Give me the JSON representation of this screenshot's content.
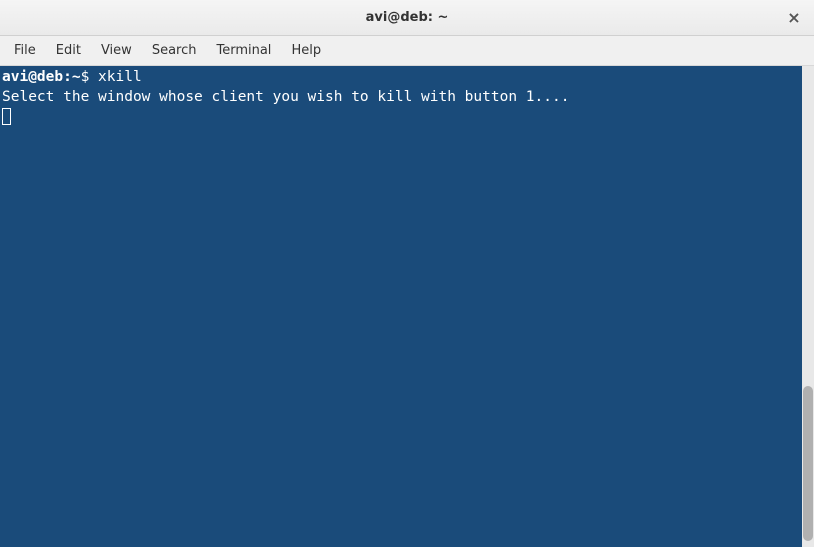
{
  "window": {
    "title": "avi@deb: ~",
    "close_label": "×"
  },
  "menu": {
    "items": [
      "File",
      "Edit",
      "View",
      "Search",
      "Terminal",
      "Help"
    ]
  },
  "terminal": {
    "prompt_user": "avi@deb",
    "prompt_path": "~",
    "prompt_symbol": "$",
    "command": "xkill",
    "output": "Select the window whose client you wish to kill with button 1...."
  }
}
